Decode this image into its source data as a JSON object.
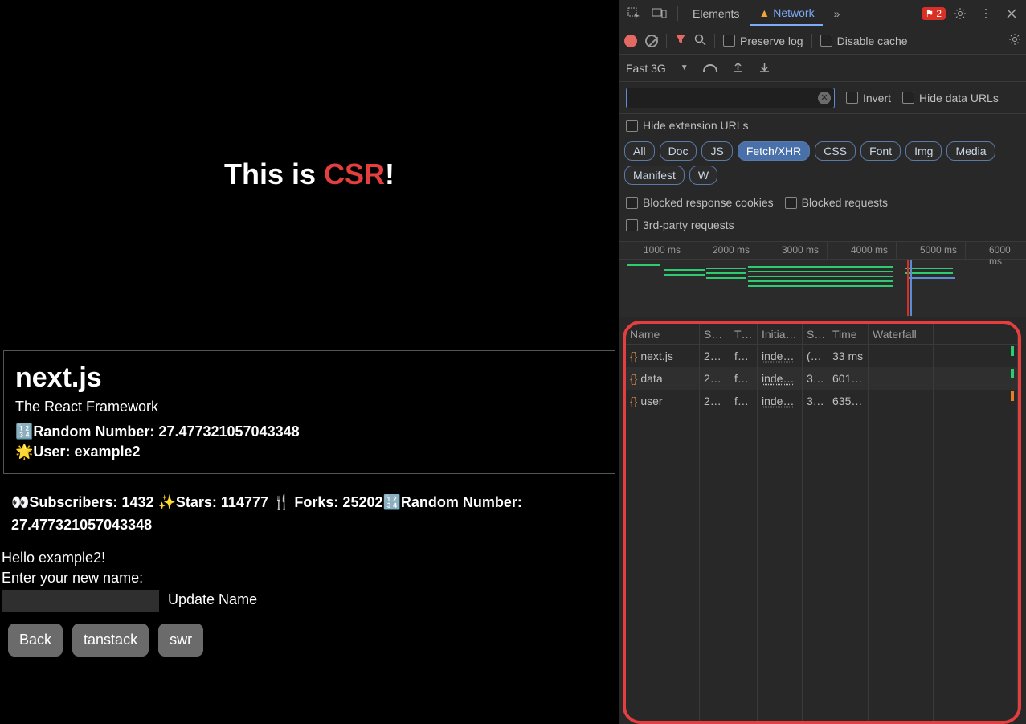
{
  "hero": {
    "prefix": "This is ",
    "csr": "CSR",
    "suffix": "!"
  },
  "card": {
    "title": "next.js",
    "subtitle": "The React Framework",
    "rand_label": "🔢Random Number: ",
    "rand_value": "27.477321057043348",
    "user_label": "🌟User: ",
    "user_value": "example2"
  },
  "stats_line": "👀Subscribers: 1432 ✨Stars: 114777 🍴 Forks: 25202🔢Random Number: 27.477321057043348",
  "form": {
    "hello": "Hello example2!",
    "prompt": "Enter your new name:",
    "update": "Update Name"
  },
  "nav": [
    "Back",
    "tanstack",
    "swr"
  ],
  "devtools": {
    "tabs": {
      "elements": "Elements",
      "network": "Network"
    },
    "errors": "2",
    "toolbar": {
      "preserve": "Preserve log",
      "disable": "Disable cache",
      "throttle": "Fast 3G",
      "invert": "Invert",
      "hide_urls": "Hide data URLs",
      "hide_ext": "Hide extension URLs",
      "blocked_cookies": "Blocked response cookies",
      "blocked_req": "Blocked requests",
      "third_party": "3rd-party requests"
    },
    "filter_pills": [
      "All",
      "Doc",
      "JS",
      "Fetch/XHR",
      "CSS",
      "Font",
      "Img",
      "Media",
      "Manifest",
      "W"
    ],
    "active_pill": "Fetch/XHR",
    "timeline_ticks": [
      "1000 ms",
      "2000 ms",
      "3000 ms",
      "4000 ms",
      "5000 ms",
      "6000 ms"
    ],
    "columns": [
      "Name",
      "S…",
      "T…",
      "Initia…",
      "S…",
      "Time",
      "Waterfall"
    ],
    "rows": [
      {
        "name": "next.js",
        "status": "2…",
        "type": "f…",
        "initiator": "inde…",
        "size": "(…",
        "time": "33 ms"
      },
      {
        "name": "data",
        "status": "2…",
        "type": "f…",
        "initiator": "inde…",
        "size": "3…",
        "time": "601…"
      },
      {
        "name": "user",
        "status": "2…",
        "type": "f…",
        "initiator": "inde…",
        "size": "3…",
        "time": "635…"
      }
    ]
  }
}
